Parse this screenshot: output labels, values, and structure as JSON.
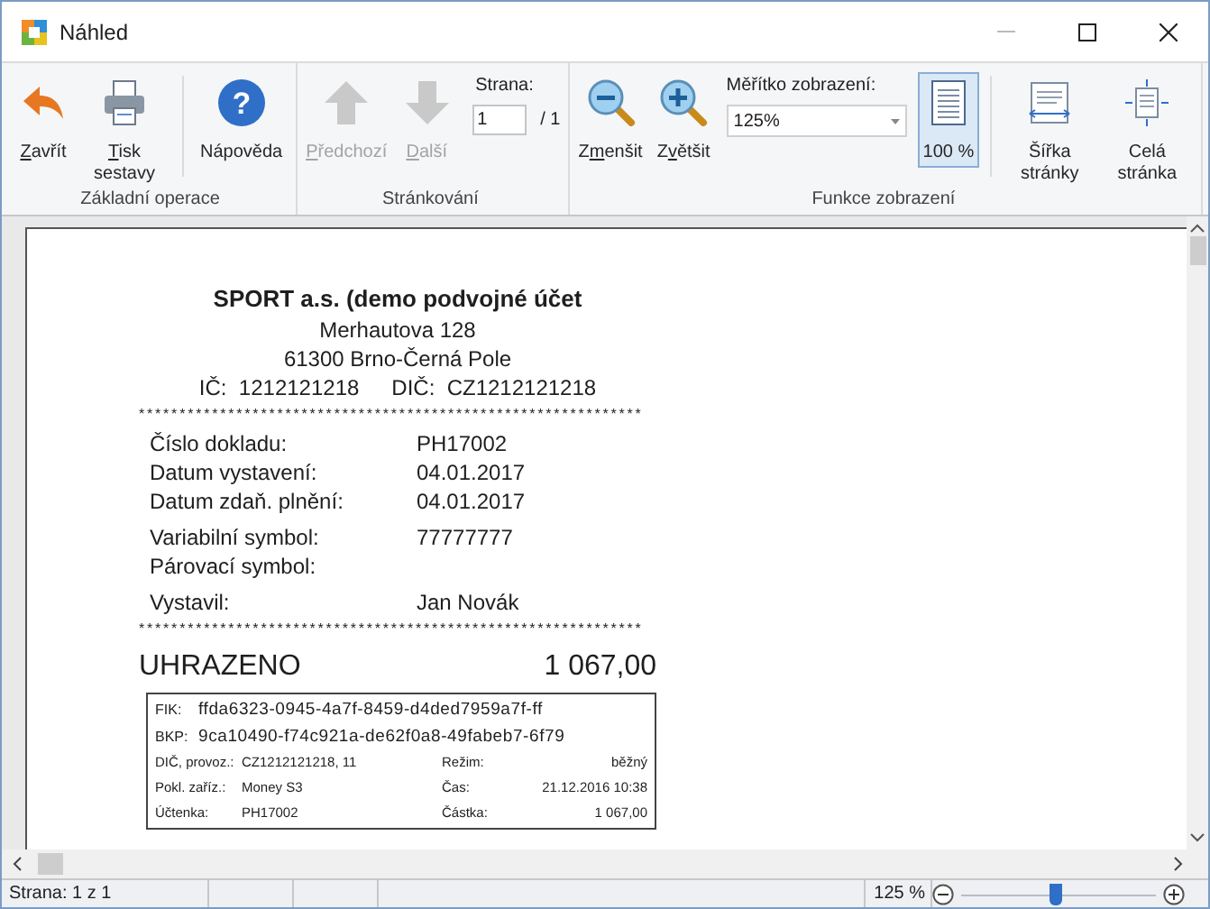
{
  "window": {
    "title": "Náhled"
  },
  "ribbon": [
    {
      "label": "Základní operace",
      "items": [
        {
          "kind": "button",
          "hotkey": "Z",
          "label_after": "avřít",
          "disabled": false,
          "selected": false
        },
        {
          "kind": "button",
          "hotkey": "T",
          "label_after": "isk sestavy",
          "disabled": false,
          "selected": false
        },
        {
          "kind": "separator"
        },
        {
          "kind": "button",
          "label_after": "Nápověda",
          "icon_text": "?",
          "disabled": false,
          "selected": false
        }
      ]
    },
    {
      "label": "Stránkování",
      "items": [
        {
          "kind": "button",
          "hotkey": "P",
          "label_after": "ředchozí",
          "disabled": true,
          "selected": false
        },
        {
          "kind": "button",
          "hotkey": "D",
          "label_after": "alší",
          "disabled": true,
          "selected": false
        },
        {
          "kind": "pager",
          "label": "Strana:",
          "value": "1",
          "total": "/ 1"
        }
      ]
    },
    {
      "label": "Funkce zobrazení",
      "items": [
        {
          "kind": "button",
          "label_before": "Z",
          "hotkey": "m",
          "label_after": "enšit",
          "disabled": false,
          "selected": false
        },
        {
          "kind": "button",
          "label_before": "Z",
          "hotkey": "v",
          "label_after": "ětšit",
          "disabled": false,
          "selected": false
        },
        {
          "kind": "combo",
          "label": "Měřítko zobrazení:",
          "value": "125%"
        },
        {
          "kind": "button",
          "label_after": "100 %",
          "disabled": false,
          "selected": true
        },
        {
          "kind": "separator"
        },
        {
          "kind": "button",
          "label_after": "Šířka stránky",
          "disabled": false,
          "selected": false
        },
        {
          "kind": "button",
          "label_after": "Celá stránka",
          "disabled": false,
          "selected": false
        }
      ]
    }
  ],
  "receipt": {
    "company": "SPORT a.s. (demo podvojné účet",
    "address": [
      "Merhautova 128",
      "61300  Brno-Černá Pole"
    ],
    "ids": [
      {
        "label": "IČ:",
        "value": "1212121218"
      },
      {
        "label": "DIČ:",
        "value": "CZ1212121218"
      }
    ],
    "separator": "**************************************************************",
    "field_groups": [
      [
        {
          "label": "Číslo dokladu:",
          "value": "PH17002"
        },
        {
          "label": "Datum vystavení:",
          "value": "04.01.2017"
        },
        {
          "label": "Datum zdaň. plnění:",
          "value": "04.01.2017"
        }
      ],
      [
        {
          "label": "Variabilní symbol:",
          "value": "77777777"
        },
        {
          "label": "Párovací symbol:"
        }
      ],
      [
        {
          "label": "Vystavil:",
          "value": "Jan Novák"
        }
      ]
    ],
    "separator_2": "**************************************************************",
    "total_label": "UHRAZENO",
    "total_value": "1 067,00",
    "eet": {
      "codes": [
        {
          "label": "FIK:",
          "value": "ffda6323-0945-4a7f-8459-d4ded7959a7f-ff"
        },
        {
          "label": "BKP:",
          "value": "9ca10490-f74c921a-de62f0a8-49fabeb7-6f79"
        }
      ],
      "rows": [
        {
          "label": "DIČ, provoz.:",
          "value": "CZ1212121218, 11",
          "label_2": "Režim:",
          "value_2": "běžný"
        },
        {
          "label": "Pokl. zaříz.:",
          "value": "Money S3",
          "label_2": "Čas:",
          "value_2": "21.12.2016 10:38"
        },
        {
          "label": "Účtenka:",
          "value": "PH17002",
          "label_2": "Částka:",
          "value_2": "1 067,00"
        }
      ]
    }
  },
  "status_bar": {
    "page_info": "Strana: 1 z 1",
    "zoom": "125 %",
    "zoom_slider": {
      "level": 0.48
    }
  }
}
